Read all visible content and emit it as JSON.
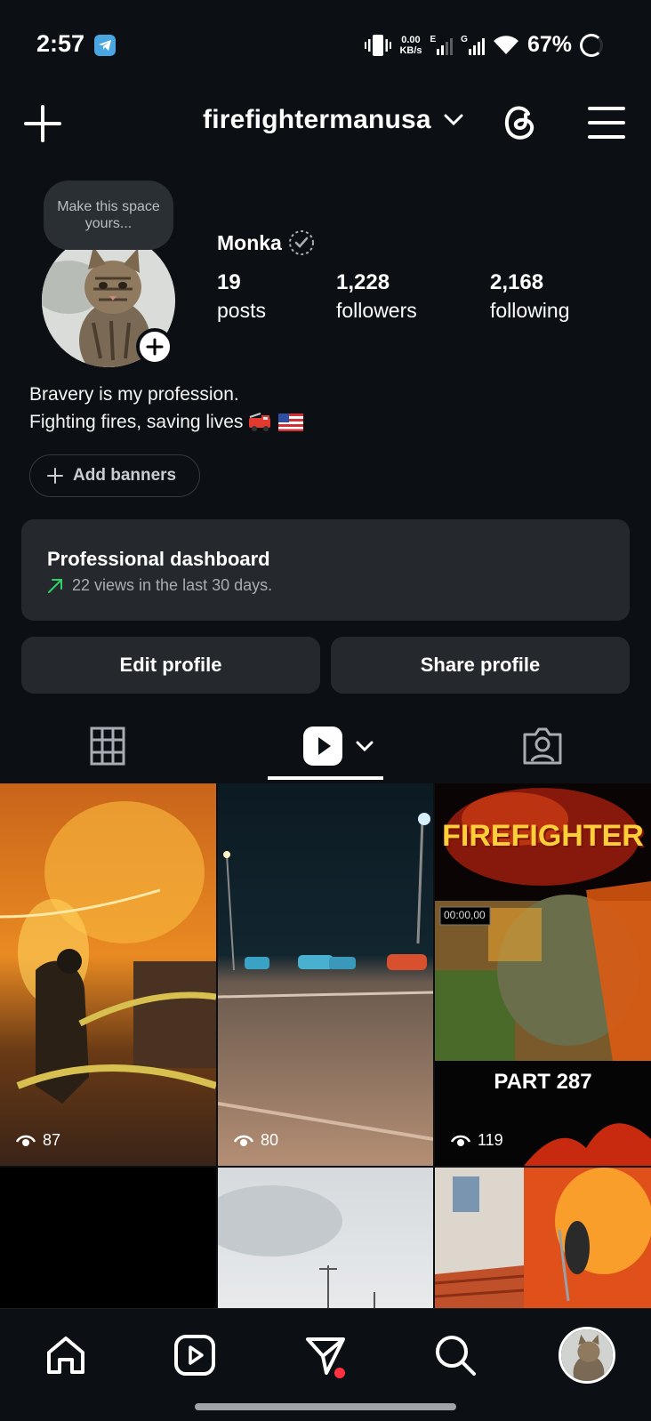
{
  "status_bar": {
    "time": "2:57",
    "net_speed_value": "0.00",
    "net_speed_unit": "KB/s",
    "net_type_1": "E",
    "net_type_2": "G",
    "battery": "67%"
  },
  "header": {
    "username": "firefightermanusa"
  },
  "profile": {
    "note_text": "Make this space yours...",
    "display_name": "Monka",
    "stats": [
      {
        "value": "19",
        "label": "posts"
      },
      {
        "value": "1,228",
        "label": "followers"
      },
      {
        "value": "2,168",
        "label": "following"
      }
    ],
    "bio_line1": "Bravery is my profession.",
    "bio_line2": "Fighting fires, saving lives",
    "add_banners": "Add banners"
  },
  "dashboard": {
    "title": "Professional dashboard",
    "subtitle": "22 views in the last 30 days."
  },
  "actions": {
    "edit": "Edit profile",
    "share": "Share profile"
  },
  "grid": {
    "items": [
      {
        "views": "87"
      },
      {
        "views": "80"
      },
      {
        "views": "119",
        "overlay_top": "FIREFIGHTER",
        "overlay_bottom": "PART 287",
        "timestamp": "00:00,00"
      }
    ]
  },
  "colors": {
    "background": "#0c1014",
    "card": "#25292e",
    "accent_green": "#2bd46a",
    "notif_red": "#ff3040"
  }
}
